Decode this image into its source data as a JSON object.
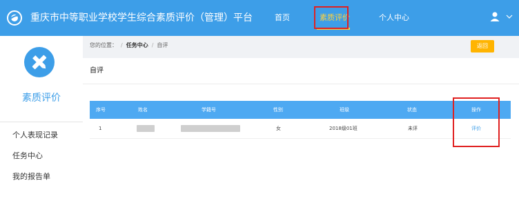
{
  "header": {
    "title": "重庆市中等职业学校学生综合素质评价（管理）平台",
    "nav": [
      "首页",
      "素质评价",
      "个人中心"
    ],
    "active_nav": "素质评价",
    "icons": [
      "logo-icon",
      "user-icon",
      "chevron-down-icon"
    ]
  },
  "sidebar": {
    "title": "素质评价",
    "badge_icon": "pencil-ruler-icon",
    "items": [
      "个人表现记录",
      "任务中心",
      "我的报告单"
    ]
  },
  "breadcrumb": {
    "prefix": "您的位置：",
    "sep": "/",
    "current": "任务中心",
    "leaf": "自评"
  },
  "back_button": "返回",
  "panel": {
    "title": "自评",
    "table": {
      "headers": [
        "序号",
        "姓名",
        "学籍号",
        "性别",
        "班级",
        "状态",
        "操作"
      ],
      "rows": [
        {
          "no": "1",
          "gender": "女",
          "class": "2018级01班",
          "status": "未评",
          "action": "评价"
        }
      ]
    }
  },
  "colors": {
    "primary": "#3d9ee8",
    "table_header": "#4ea9f2",
    "nav_active": "#ffd23c",
    "back_button": "#ffb400",
    "highlight": "#e02020"
  }
}
